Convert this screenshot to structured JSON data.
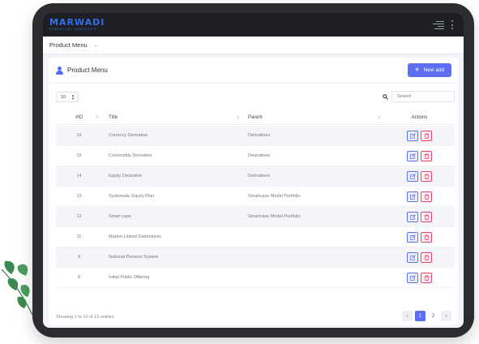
{
  "brand": {
    "name": "MARWADI",
    "subtitle": "FINANCIAL SERVICES"
  },
  "breadcrumb": {
    "title": "Product Menu",
    "back_icon": "arrow-left-icon"
  },
  "card": {
    "title": "Product Menu",
    "new_button_label": "New add"
  },
  "controls": {
    "page_length": "10",
    "search_placeholder": "Search"
  },
  "table": {
    "headers": {
      "id": "#ID",
      "title": "Title",
      "parent": "Parent",
      "actions": "Actions"
    },
    "rows": [
      {
        "id": "16",
        "title": "Currency Derivative",
        "parent": "Derivatives"
      },
      {
        "id": "15",
        "title": "Commodity Derivative",
        "parent": "Derivatives"
      },
      {
        "id": "14",
        "title": "Equity Derivative",
        "parent": "Derivatives"
      },
      {
        "id": "13",
        "title": "Systematic Equity Plan",
        "parent": "Smartcase Model Portfolio"
      },
      {
        "id": "12",
        "title": "Smart case",
        "parent": "Smartcase Model Portfolio"
      },
      {
        "id": "11",
        "title": "Market-Linked Debentures",
        "parent": ""
      },
      {
        "id": "9",
        "title": "National Pension System",
        "parent": ""
      },
      {
        "id": "8",
        "title": "Initial Public Offering",
        "parent": ""
      }
    ]
  },
  "footer": {
    "info": "Showing 1 to 10 of 13 entries",
    "pages": [
      "1",
      "2"
    ],
    "current_page": "1"
  },
  "colors": {
    "accent": "#5b6ff0",
    "danger": "#ef3e6c",
    "topbar": "#1d1f24",
    "brand": "#2f6fe8"
  }
}
